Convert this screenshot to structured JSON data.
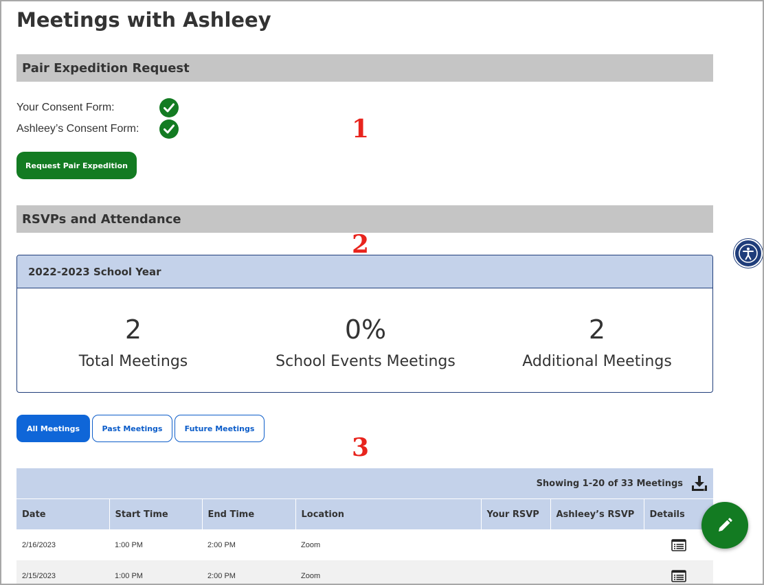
{
  "page": {
    "title": "Meetings with Ashleey"
  },
  "pair_expedition": {
    "heading": "Pair Expedition Request",
    "your_consent_label": "Your Consent Form:",
    "partner_consent_label": "Ashleey’s Consent Form:",
    "request_button": "Request Pair Expedition"
  },
  "rsvp": {
    "heading": "RSVPs and Attendance",
    "year_label": "2022-2023 School Year",
    "stats": [
      {
        "value": "2",
        "label": "Total Meetings"
      },
      {
        "value": "0%",
        "label": "School Events Meetings"
      },
      {
        "value": "2",
        "label": "Additional Meetings"
      }
    ]
  },
  "filters": [
    "All Meetings",
    "Past Meetings",
    "Future Meetings"
  ],
  "table": {
    "showing": "Showing 1-20 of 33 Meetings",
    "columns": [
      "Date",
      "Start Time",
      "End Time",
      "Location",
      "Your RSVP",
      "Ashleey’s RSVP",
      "Details"
    ],
    "rows": [
      {
        "date": "2/16/2023",
        "start": "1:00 PM",
        "end": "2:00 PM",
        "location": "Zoom",
        "your_rsvp": "",
        "partner_rsvp": ""
      },
      {
        "date": "2/15/2023",
        "start": "1:00 PM",
        "end": "2:00 PM",
        "location": "Zoom",
        "your_rsvp": "",
        "partner_rsvp": ""
      }
    ]
  },
  "markers": [
    "1",
    "2",
    "3"
  ],
  "icons": {
    "check": "check-circle-icon",
    "download": "download-icon",
    "details": "list-details-icon",
    "accessibility": "accessibility-icon",
    "edit": "pencil-icon"
  },
  "colors": {
    "green": "#137b22",
    "blue_primary": "#0f66d8",
    "header_blue": "#c4d2ea",
    "section_gray": "#c5c5c5",
    "marker_red": "#e8241d"
  }
}
